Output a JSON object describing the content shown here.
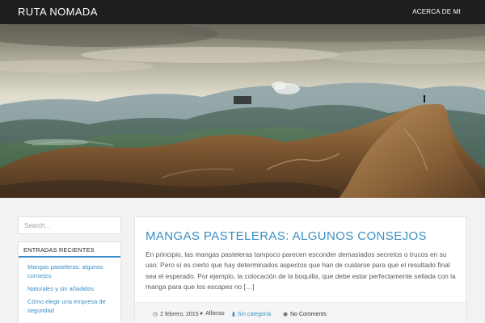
{
  "header": {
    "site_title": "RUTA NOMADA",
    "nav_items": [
      "ACERCA DE MI"
    ]
  },
  "hero": {
    "icon": "mountain-landscape-image"
  },
  "sidebar": {
    "search_placeholder": "Search...",
    "recent_posts": {
      "title": "ENTRADAS RECIENTES",
      "items": [
        {
          "label": "Mangas pasteleras: algunos consejos"
        },
        {
          "label": "Naturales y sin añadidos"
        },
        {
          "label": "Cómo elegir una empresa de seguridad"
        }
      ]
    }
  },
  "post": {
    "title": "MANGAS PASTELERAS: ALGUNOS CONSEJOS",
    "excerpt": "En principio, las mangas pasteleras tampoco parecen esconder demasiados secretos o trucos en su uso. Pero sí es cierto que hay determinados aspectos que han de cuidarse para que el resultado final sea el esperado. Por ejemplo, la colocación de la boquilla, que debe estar perfectamente sellada con la manga para que los escapes no […]",
    "meta": {
      "date": "2 febrero, 2015",
      "author": "Alfonso",
      "category": "Sin categoría",
      "comments": "No Comments"
    }
  },
  "colors": {
    "accent": "#3a8fc4",
    "topbar": "#1e1e1e",
    "background": "#f2f2f2"
  }
}
